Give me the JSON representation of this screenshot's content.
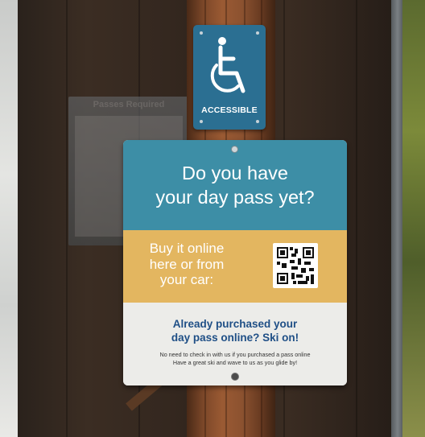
{
  "accessible_sign": {
    "label": "ACCESSIBLE",
    "icon": "wheelchair-icon",
    "color": "#2b6f92"
  },
  "main_sign": {
    "headline_line1": "Do you have",
    "headline_line2": "your day pass yet?",
    "buy_line1": "Buy it online",
    "buy_line2": "here or from",
    "buy_line3": "your car:",
    "qr_icon": "qr-code-icon",
    "skion_line1": "Already purchased your",
    "skion_line2": "day pass online? Ski on!",
    "fine_line1": "No need to check in with us if you purchased a pass online",
    "fine_line2": "Have a great ski and wave to us as you glide by!",
    "colors": {
      "top_band": "#3d8ea6",
      "middle_band": "#e3b660",
      "bottom_band": "#ecece9",
      "skion_text": "#1f4f86"
    }
  },
  "background_notice": {
    "text": "Passes Required"
  }
}
